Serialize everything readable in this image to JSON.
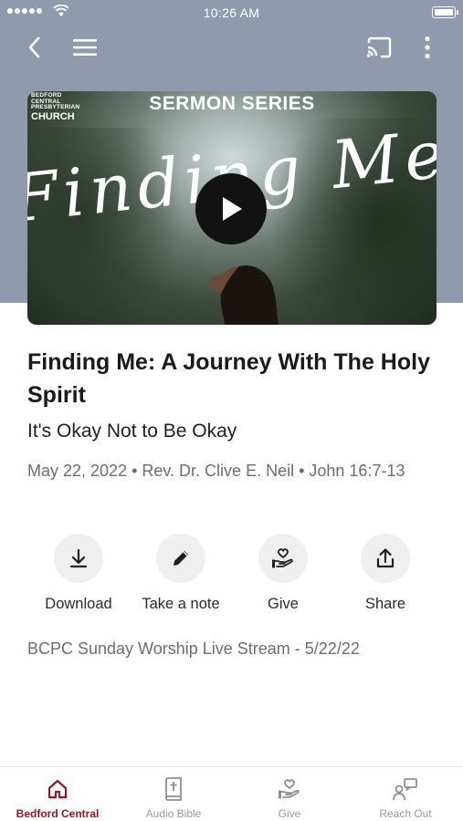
{
  "status_bar": {
    "time": "10:26 AM"
  },
  "top_nav": {
    "icons": [
      "back-icon",
      "menu-icon",
      "cast-icon",
      "more-icon"
    ]
  },
  "hero": {
    "church_logo": {
      "line1": "BEDFORD",
      "line2": "CENTRAL",
      "line3": "PRESBYTERIAN",
      "line4": "CHURCH"
    },
    "series_label": "SERMON SERIES",
    "script_title": "Finding Me"
  },
  "sermon": {
    "title": "Finding Me: A Journey With The Holy Spirit",
    "subtitle": "It's Okay Not to Be Okay",
    "meta": "May 22, 2022 • Rev. Dr. Clive E. Neil • John 16:7-13"
  },
  "actions": [
    {
      "label": "Download",
      "icon": "download-icon"
    },
    {
      "label": "Take a note",
      "icon": "pencil-icon"
    },
    {
      "label": "Give",
      "icon": "give-hand-heart-icon"
    },
    {
      "label": "Share",
      "icon": "share-icon"
    }
  ],
  "stream_label": "BCPC Sunday Worship Live Stream - 5/22/22",
  "tabs": [
    {
      "label": "Bedford Central",
      "icon": "home-icon",
      "active": true
    },
    {
      "label": "Audio Bible",
      "icon": "bible-icon",
      "active": false
    },
    {
      "label": "Give",
      "icon": "give-hand-heart-icon",
      "active": false
    },
    {
      "label": "Reach Out",
      "icon": "reach-out-icon",
      "active": false
    }
  ],
  "colors": {
    "header_bg": "#909aac",
    "accent": "#8b1c24",
    "muted_text": "#6d6d6d",
    "action_circle": "#efeff0"
  }
}
